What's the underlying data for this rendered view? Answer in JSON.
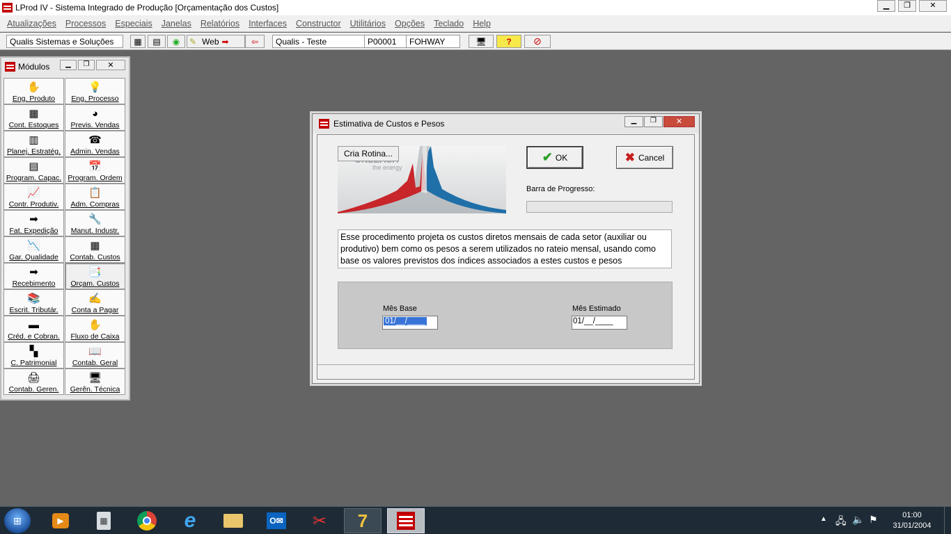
{
  "window": {
    "title": "LProd IV - Sistema Integrado de Produção [Orçamentação dos Custos]",
    "buttons": [
      "▁",
      "❐",
      "✕"
    ]
  },
  "menu": [
    "Atualizações",
    "Processos",
    "Especiais",
    "Janelas",
    "Relatórios",
    "Interfaces",
    "Constructor",
    "Utilitários",
    "Opções",
    "Teclado",
    "Help"
  ],
  "toolbar": {
    "company": "Qualis Sistemas e Soluções",
    "web_label": "Web",
    "environment": "Qualis - Teste",
    "code": "P00001",
    "user": "FOHWAY"
  },
  "modules": {
    "title": "Módulos",
    "items": [
      {
        "label": "Eng. Produto",
        "icon": "✋"
      },
      {
        "label": "Eng. Processo",
        "icon": "💡"
      },
      {
        "label": "Cont. Estoques",
        "icon": "▦"
      },
      {
        "label": "Previs. Vendas",
        "icon": "◕"
      },
      {
        "label": "Planej. Estratég.",
        "icon": "▥"
      },
      {
        "label": "Admin. Vendas",
        "icon": "☎"
      },
      {
        "label": "Program. Capac.",
        "icon": "▤"
      },
      {
        "label": "Program. Ordem",
        "icon": "📅"
      },
      {
        "label": "Contr. Produtiv.",
        "icon": "📈"
      },
      {
        "label": "Adm. Compras",
        "icon": "📋"
      },
      {
        "label": "Fat. Expedição",
        "icon": "➡"
      },
      {
        "label": "Manut. Industr.",
        "icon": "🔧"
      },
      {
        "label": "Gar. Qualidade",
        "icon": "📉"
      },
      {
        "label": "Contab. Custos",
        "icon": "▦"
      },
      {
        "label": "Recebimento",
        "icon": "➡"
      },
      {
        "label": "Orçam. Custos",
        "icon": "📑"
      },
      {
        "label": "Escrit. Tributár.",
        "icon": "📚"
      },
      {
        "label": "Conta a Pagar",
        "icon": "✍"
      },
      {
        "label": "Créd. e Cobran.",
        "icon": "▬"
      },
      {
        "label": "Fluxo de Caixa",
        "icon": "✋"
      },
      {
        "label": "C. Patrimonial",
        "icon": "▚"
      },
      {
        "label": "Contab. Geral",
        "icon": "📖"
      },
      {
        "label": "Contab. Geren.",
        "icon": "🖨"
      },
      {
        "label": "Gerên. Técnica",
        "icon": "🖥"
      }
    ]
  },
  "dialog": {
    "title": "Estimativa de Custos e Pesos",
    "cria_rotina": "Cria Rotina...",
    "banner_text": "ONLEASH",
    "banner_sub": "the energy",
    "ok_label": "OK",
    "cancel_label": "Cancel",
    "progress_label": "Barra de Progresso:",
    "progress_value": 0,
    "description": "Esse procedimento projeta os custos diretos mensais de cada setor (auxiliar ou produtivo) bem como os pesos a serem utilizados no rateio mensal, usando como base os valores previstos dos índices associados a estes custos e pesos",
    "mes_base_label": "Mês Base",
    "mes_base_value": "01/__/____",
    "mes_estimado_label": "Mês Estimado",
    "mes_estimado_value": "01/__/____"
  },
  "taskbar": {
    "clock_time": "01:00",
    "clock_date": "31/01/2004"
  },
  "colors": {
    "desktop": "#646464",
    "ok_check": "#2e9e2e",
    "cancel_x": "#c81e1e",
    "selection": "#3874d8"
  }
}
